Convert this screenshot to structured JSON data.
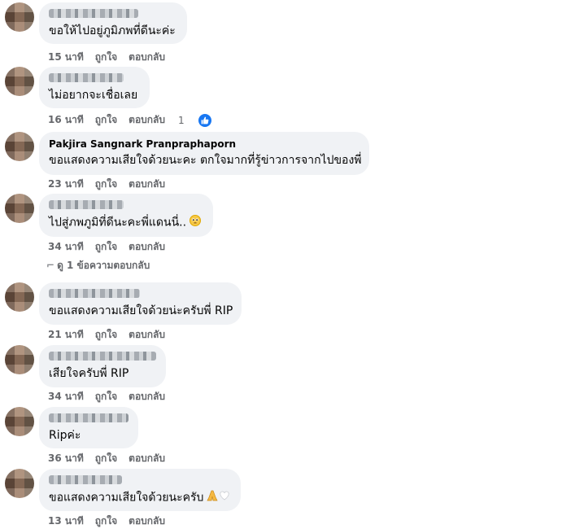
{
  "comments": [
    {
      "name": "",
      "text": "ขอให้ไปอยู่ภูมิภพที่ดีนะค่ะ",
      "time": "15 นาที",
      "like": "ถูกใจ",
      "reply": "ตอบกลับ"
    },
    {
      "name": "",
      "text": "ไม่อยากจะเชื่อเลย",
      "time": "16 นาที",
      "like": "ถูกใจ",
      "reply": "ตอบกลับ",
      "reaction_count": "1",
      "reaction_icon": "like-icon"
    },
    {
      "name": "Pakjira Sangnark Pranpraphaporn",
      "text": "ขอแสดงความเสียใจด้วยนะคะ ตกใจมากที่รู้ข่าวการจากไปของพี่",
      "time": "23 นาที",
      "like": "ถูกใจ",
      "reply": "ตอบกลับ"
    },
    {
      "name": "",
      "text": "ไปสู่ภพภูมิที่ดีนะคะพี่แดนนี่..",
      "emoji": "pleading-face-icon",
      "time": "34 นาที",
      "like": "ถูกใจ",
      "reply": "ตอบกลับ"
    },
    {
      "name": "",
      "text": "ขอแสดงความเสียใจด้วยน่ะครับพี่ RIP",
      "time": "21 นาที",
      "like": "ถูกใจ",
      "reply": "ตอบกลับ"
    },
    {
      "name": "",
      "text": "เสียใจครับพี่ RIP",
      "time": "34 นาที",
      "like": "ถูกใจ",
      "reply": "ตอบกลับ"
    },
    {
      "name": "",
      "text": "Ripค่ะ",
      "time": "36 นาที",
      "like": "ถูกใจ",
      "reply": "ตอบกลับ"
    },
    {
      "name": "",
      "text": "ขอแสดงความเสียใจด้วยนะครับ",
      "emoji": "praying-hands-white-heart-icon",
      "time": "13 นาที",
      "like": "ถูกใจ",
      "reply": "ตอบกลับ"
    }
  ],
  "view_replies": "ดู 1 ข้อความตอบกลับ",
  "colors": {
    "bubble": "#f0f2f5",
    "meta": "#65676b",
    "like_blue": "#1877f2"
  }
}
